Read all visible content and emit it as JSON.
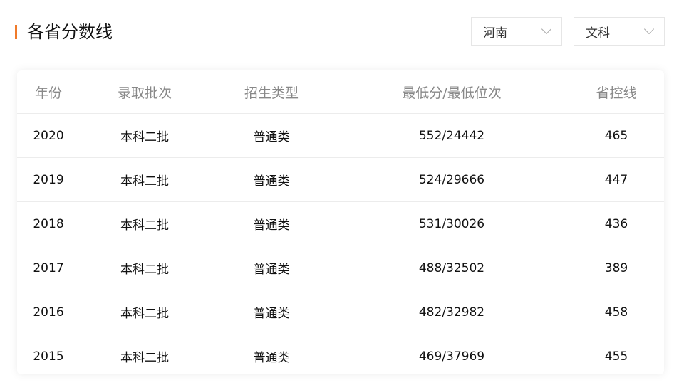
{
  "title": "各省分数线",
  "filters": {
    "province": "河南",
    "subject": "文科"
  },
  "table": {
    "headers": [
      "年份",
      "录取批次",
      "招生类型",
      "最低分/最低位次",
      "省控线"
    ],
    "rows": [
      [
        "2020",
        "本科二批",
        "普通类",
        "552/24442",
        "465"
      ],
      [
        "2019",
        "本科二批",
        "普通类",
        "524/29666",
        "447"
      ],
      [
        "2018",
        "本科二批",
        "普通类",
        "531/30026",
        "436"
      ],
      [
        "2017",
        "本科二批",
        "普通类",
        "488/32502",
        "389"
      ],
      [
        "2016",
        "本科二批",
        "普通类",
        "482/32982",
        "458"
      ],
      [
        "2015",
        "本科二批",
        "普通类",
        "469/37969",
        "455"
      ]
    ]
  }
}
